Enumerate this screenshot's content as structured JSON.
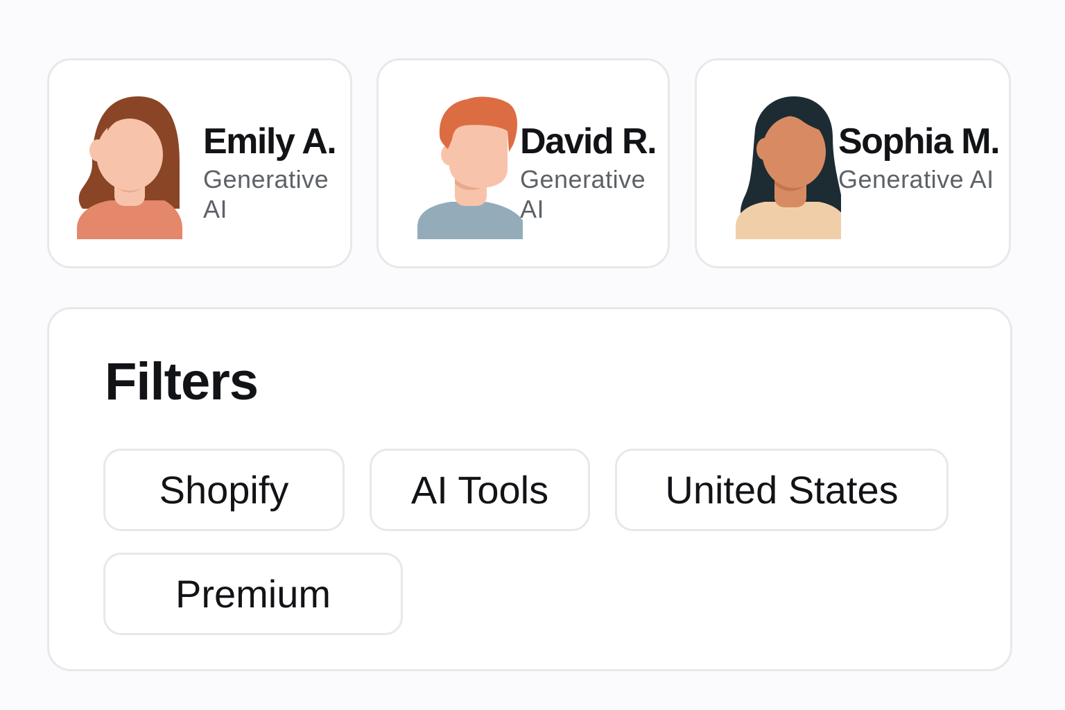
{
  "people": [
    {
      "name": "Emily A.",
      "role": "Generative AI"
    },
    {
      "name": "David R.",
      "role": "Generative AI"
    },
    {
      "name": "Sophia M.",
      "role": "Generative AI"
    }
  ],
  "filters": {
    "title": "Filters",
    "chips": [
      "Shopify",
      "AI Tools",
      "United States",
      "Premium"
    ]
  },
  "colors": {
    "background": "#fbfafc",
    "card": "#ffffff",
    "border": "#e8e7ea",
    "text": "#111316",
    "muted_text": "#5d6167",
    "emily_hair": "#8a4526",
    "emily_shirt": "#e4876a",
    "david_hair": "#dc6d43",
    "david_shirt": "#94acba",
    "sophia_hair": "#1d2b33",
    "sophia_shirt": "#f0cfa8"
  },
  "icons": [
    "avatar-woman-brown-hair",
    "avatar-man-red-hair",
    "avatar-woman-dark-hair"
  ]
}
